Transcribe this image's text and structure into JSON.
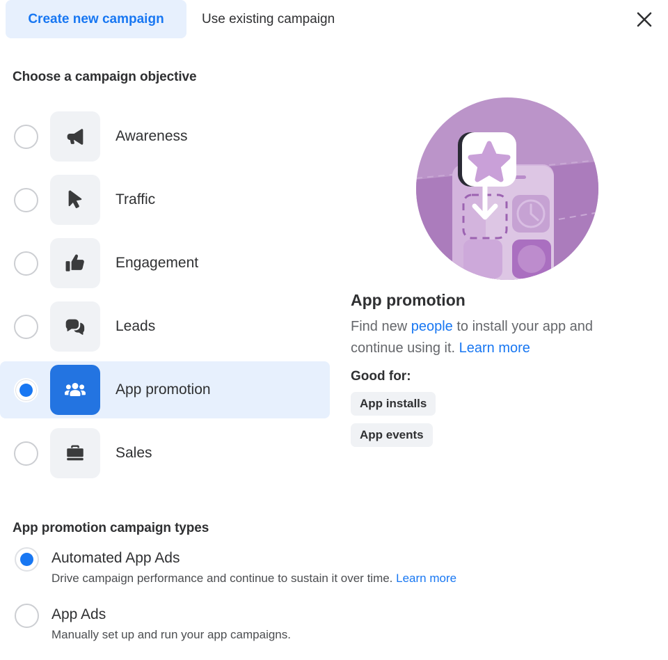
{
  "tabs": {
    "active_label": "Create new campaign",
    "inactive_label": "Use existing campaign",
    "close_icon": "close-icon"
  },
  "colors": {
    "accent_blue": "#1877f2",
    "tile_blue": "#2374e1",
    "selected_row_bg": "#e7f0fd",
    "tile_gray": "#f0f2f5",
    "body_text_gray": "#65676b",
    "illustration_purple": "#bb94c9"
  },
  "objective_section": {
    "title": "Choose a campaign objective",
    "items": [
      {
        "label": "Awareness",
        "icon": "megaphone-icon",
        "selected": false
      },
      {
        "label": "Traffic",
        "icon": "cursor-arrow-icon",
        "selected": false
      },
      {
        "label": "Engagement",
        "icon": "thumbs-up-icon",
        "selected": false
      },
      {
        "label": "Leads",
        "icon": "chat-bubbles-icon",
        "selected": false
      },
      {
        "label": "App promotion",
        "icon": "people-group-icon",
        "selected": true
      },
      {
        "label": "Sales",
        "icon": "briefcase-icon",
        "selected": false
      }
    ]
  },
  "info_panel": {
    "illustration": "app-install-illustration",
    "title": "App promotion",
    "desc_part1": "Find new ",
    "desc_link1": "people",
    "desc_part2": " to install your app and continue using it. ",
    "desc_link2": "Learn more",
    "good_for_label": "Good for:",
    "chips": [
      "App installs",
      "App events"
    ]
  },
  "types_section": {
    "title": "App promotion campaign types",
    "options": [
      {
        "label": "Automated App Ads",
        "desc": "Drive campaign performance and continue to sustain it over time. ",
        "link": "Learn more",
        "selected": true
      },
      {
        "label": "App Ads",
        "desc": "Manually set up and run your app campaigns.",
        "link": "",
        "selected": false
      }
    ]
  }
}
